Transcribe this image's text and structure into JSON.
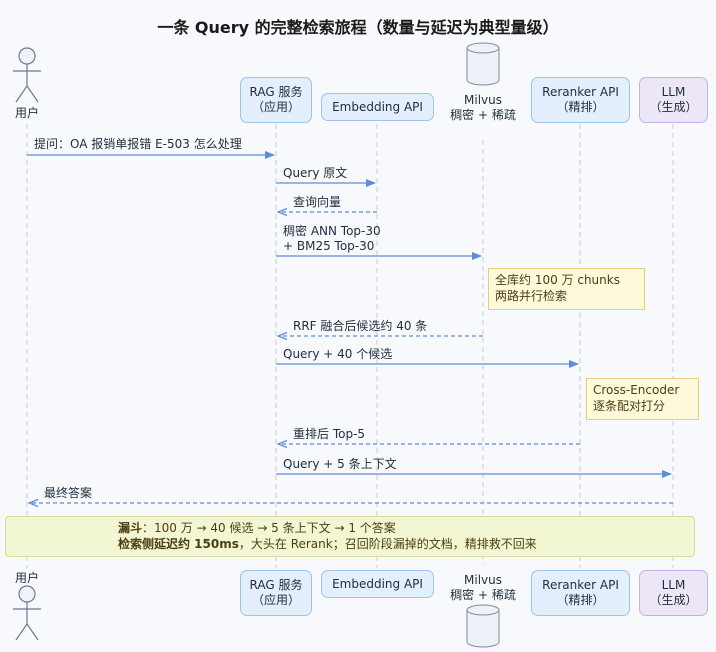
{
  "title": "一条 Query 的完整检索旅程（数量与延迟为典型量级）",
  "participants": {
    "user": "用户",
    "rag_line1": "RAG 服务",
    "rag_line2": "（应用）",
    "embedding": "Embedding API",
    "milvus_line1": "Milvus",
    "milvus_line2": "稠密 + 稀疏",
    "reranker_line1": "Reranker API",
    "reranker_line2": "（精排）",
    "llm_line1": "LLM",
    "llm_line2": "（生成）"
  },
  "messages": {
    "m1": "提问：OA 报销单报错 E-503 怎么处理",
    "m2": "Query 原文",
    "m3": "查询向量",
    "m4_line1": "稠密 ANN Top-30",
    "m4_line2": "+ BM25 Top-30",
    "m5": "RRF 融合后候选约 40 条",
    "m6": "Query + 40 个候选",
    "m7": "重排后 Top-5",
    "m8": "Query + 5 条上下文",
    "m9": "最终答案"
  },
  "notes": {
    "n1_line1": "全库约 100 万 chunks",
    "n1_line2": "两路并行检索",
    "n2_line1": "Cross-Encoder",
    "n2_line2": "逐条配对打分",
    "n3_bold1": "漏斗",
    "n3_text1": "：100 万 → 40 候选 → 5 条上下文 → 1 个答案",
    "n3_bold2": "检索侧延迟约 150ms",
    "n3_text2": "，大头在 Rerank；召回阶段漏掉的文档，精排救不回来"
  },
  "colors": {
    "arrow": "#5b8ddb",
    "lifeline": "#c6ccd6",
    "participant_fill": "#e3effd",
    "llm_fill": "#ece6f6",
    "note_fill": "#fff9dc",
    "summary_fill": "#f3f6d3"
  }
}
